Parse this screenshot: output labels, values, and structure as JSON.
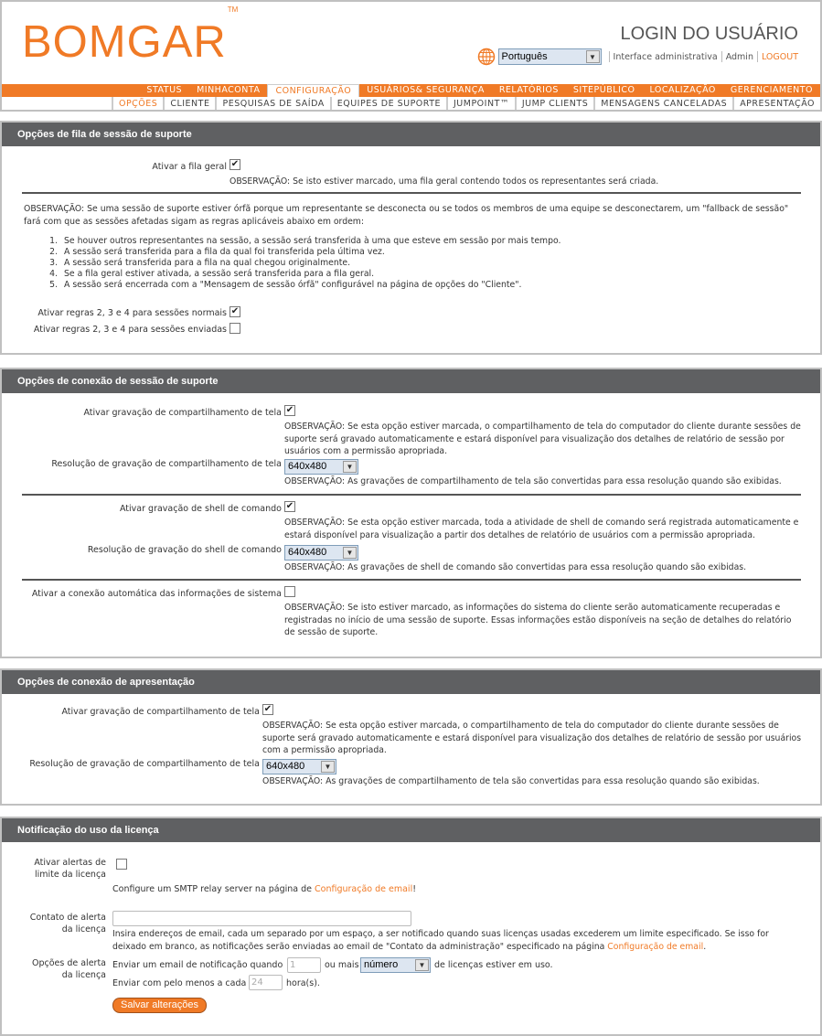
{
  "header": {
    "logo": "BOMGAR",
    "logo_tm": "TM",
    "title": "LOGIN DO USUÁRIO",
    "language": "Português",
    "admin_interface": "Interface administrativa",
    "user": "Admin",
    "logout": "LOGOUT"
  },
  "nav": {
    "primary": [
      "STATUS",
      "MINHACONTA",
      "CONFIGURAÇÃO",
      "USUÁRIOS& SEGURANÇA",
      "RELATÓRIOS",
      "SITEPÚBLICO",
      "LOCALIZAÇÃO",
      "GERENCIAMENTO"
    ],
    "primary_active": 2,
    "secondary": [
      "OPÇÕES",
      "CLIENTE",
      "PESQUISAS DE SAÍDA",
      "EQUIPES DE SUPORTE",
      "JUMPOINT™",
      "JUMP CLIENTS",
      "MENSAGENS CANCELADAS",
      "APRESENTAÇÃO"
    ],
    "secondary_active": 0
  },
  "queue": {
    "title": "Opções de fila de sessão de suporte",
    "general_queue_label": "Ativar a fila geral",
    "general_queue_checked": true,
    "general_queue_note": "OBSERVAÇÃO: Se isto estiver marcado, uma fila geral contendo todos os representantes será criada.",
    "fallback_note": "OBSERVAÇÃO: Se uma sessão de suporte estiver órfã porque um representante se desconecta ou se todos os membros de uma equipe se desconectarem, um \"fallback de sessão\" fará com que as sessões afetadas sigam as regras aplicáveis abaixo em ordem:",
    "rules": [
      "Se houver outros representantes na sessão, a sessão será transferida à uma que esteve em sessão por mais tempo.",
      "A sessão será transferida para a fila da qual foi transferida pela última vez.",
      "A sessão será transferida para a fila na qual chegou originalmente.",
      "Se a fila geral estiver ativada, a sessão será transferida para a fila geral.",
      "A sessão será encerrada com a \"Mensagem de sessão órfã\" configurável na página de opções do \"Cliente\"."
    ],
    "rules_normal_label": "Ativar regras 2, 3 e 4 para sessões normais",
    "rules_normal_checked": true,
    "rules_pushed_label": "Ativar regras 2, 3 e 4 para sessões enviadas",
    "rules_pushed_checked": false
  },
  "connection": {
    "title": "Opções de conexão de sessão de suporte",
    "screen_rec_label": "Ativar gravação de compartilhamento de tela",
    "screen_rec_checked": true,
    "screen_rec_note": "OBSERVAÇÃO: Se esta opção estiver marcada, o compartilhamento de tela do computador do cliente durante sessões de suporte será gravado automaticamente e estará disponível para visualização dos detalhes de relatório de sessão por usuários com a permissão apropriada.",
    "screen_res_label": "Resolução de gravação de compartilhamento de tela",
    "screen_res_value": "640x480",
    "screen_res_note": "OBSERVAÇÃO: As gravações de compartilhamento de tela são convertidas para essa resolução quando são exibidas.",
    "shell_rec_label": "Ativar gravação de shell de comando",
    "shell_rec_checked": true,
    "shell_rec_note": "OBSERVAÇÃO: Se esta opção estiver marcada, toda a atividade de shell de comando será registrada automaticamente e estará disponível para visualização a partir dos detalhes de relatório de usuários com a permissão apropriada.",
    "shell_res_label": "Resolução de gravação do shell de comando",
    "shell_res_value": "640x480",
    "shell_res_note": "OBSERVAÇÃO: As gravações de shell de comando são convertidas para essa resolução quando são exibidas.",
    "sysinfo_label": "Ativar a conexão automática das informações de sistema",
    "sysinfo_checked": false,
    "sysinfo_note": "OBSERVAÇÃO: Se isto estiver marcado, as informações do sistema do cliente serão automaticamente recuperadas e registradas no início de uma sessão de suporte. Essas informações estão disponíveis na seção de detalhes do relatório de sessão de suporte."
  },
  "presentation": {
    "title": "Opções de conexão de apresentação",
    "screen_rec_label": "Ativar gravação de compartilhamento de tela",
    "screen_rec_checked": true,
    "screen_rec_note": "OBSERVAÇÃO: Se esta opção estiver marcada, o compartilhamento de tela do computador do cliente durante sessões de suporte será gravado automaticamente e estará disponível para visualização dos detalhes de relatório de sessão por usuários com a permissão apropriada.",
    "screen_res_label": "Resolução de gravação de compartilhamento de tela",
    "screen_res_value": "640x480",
    "screen_res_note": "OBSERVAÇÃO: As gravações de compartilhamento de tela são convertidas para essa resolução quando são exibidas."
  },
  "license": {
    "title": "Notificação do uso da licença",
    "alerts_label_1": "Ativar alertas de",
    "alerts_label_2": "limite da licença",
    "alerts_checked": false,
    "smtp_pre": "Configure um SMTP relay server na página de ",
    "smtp_link": "Configuração de email",
    "smtp_post": "!",
    "contact_label_1": "Contato de alerta",
    "contact_label_2": "da licença",
    "contact_value": "",
    "contact_note_pre": "Insira endereços de email, cada um separado por um espaço, a ser notificado quando suas licenças usadas excederem um limite especificado. Se isso for deixado em branco, as notificações serão enviadas ao email de \"Contato da administração\" especificado na página ",
    "contact_note_link": "Configuração de email",
    "contact_note_post": ".",
    "options_label_1": "Opções de alerta",
    "options_label_2": "da licença",
    "send_when": "Enviar um email de notificação quando",
    "threshold_value": "1",
    "or_more": "ou mais",
    "unit_value": "número",
    "licenses_in_use": "de licenças estiver em uso.",
    "send_every": "Enviar com pelo menos a cada",
    "hours_value": "24",
    "hours_unit": "hora(s).",
    "save_button": "Salvar alterações"
  }
}
